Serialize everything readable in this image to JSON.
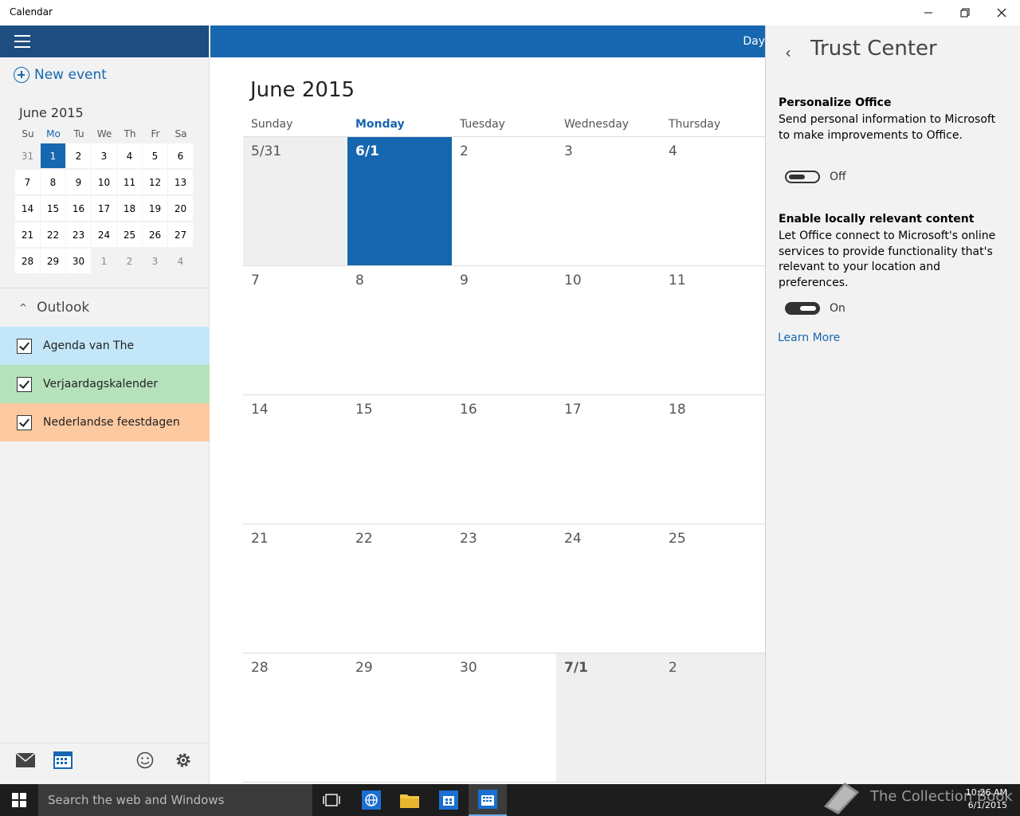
{
  "window": {
    "title": "Calendar"
  },
  "sidebar": {
    "new_event": "New event",
    "mini_calendar": {
      "title": "June 2015",
      "day_headers": [
        "Su",
        "Mo",
        "Tu",
        "We",
        "Th",
        "Fr",
        "Sa"
      ],
      "weeks": [
        [
          "31",
          "1",
          "2",
          "3",
          "4",
          "5",
          "6"
        ],
        [
          "7",
          "8",
          "9",
          "10",
          "11",
          "12",
          "13"
        ],
        [
          "14",
          "15",
          "16",
          "17",
          "18",
          "19",
          "20"
        ],
        [
          "21",
          "22",
          "23",
          "24",
          "25",
          "26",
          "27"
        ],
        [
          "28",
          "29",
          "30",
          "1",
          "2",
          "3",
          "4"
        ]
      ]
    },
    "account": "Outlook",
    "calendars": [
      {
        "name": "Agenda van The",
        "color": "#c3e6f8"
      },
      {
        "name": "Verjaardagskalender",
        "color": "#b5e2ba"
      },
      {
        "name": "Nederlandse feestdagen",
        "color": "#fdc9a0"
      }
    ]
  },
  "main": {
    "view_label": "Day",
    "month_title": "June 2015",
    "weekdays": [
      "Sunday",
      "Monday",
      "Tuesday",
      "Wednesday",
      "Thursday"
    ],
    "weeks": [
      [
        "5/31",
        "6/1",
        "2",
        "3",
        "4"
      ],
      [
        "7",
        "8",
        "9",
        "10",
        "11"
      ],
      [
        "14",
        "15",
        "16",
        "17",
        "18"
      ],
      [
        "21",
        "22",
        "23",
        "24",
        "25"
      ],
      [
        "28",
        "29",
        "30",
        "7/1",
        "2"
      ]
    ]
  },
  "trust_center": {
    "title": "Trust Center",
    "sections": [
      {
        "heading": "Personalize Office",
        "description": "Send personal information to Microsoft to make improvements to Office.",
        "toggle_state": "Off"
      },
      {
        "heading": "Enable locally relevant content",
        "description": "Let Office connect to Microsoft's online services to provide functionality that's relevant to your location and preferences.",
        "toggle_state": "On"
      }
    ],
    "learn_more": "Learn More"
  },
  "taskbar": {
    "search_placeholder": "Search the web and Windows",
    "time": "10:26 AM",
    "date": "6/1/2015",
    "watermark": "The Collection Book"
  },
  "colors": {
    "accent": "#1666b0",
    "dark_accent": "#1e4e80"
  }
}
